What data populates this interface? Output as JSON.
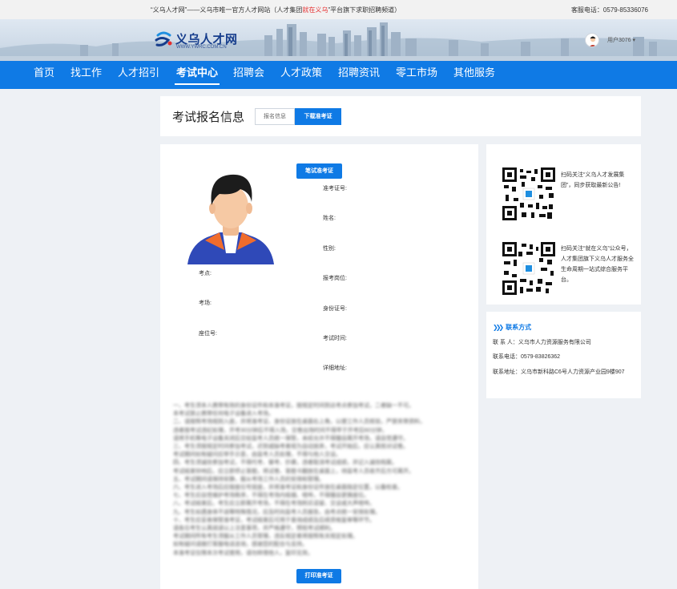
{
  "topbar": {
    "tagline_prefix": "“义乌人才网”——义乌市唯一官方人才网站（人才集团",
    "tagline_red": "就在义乌",
    "tagline_suffix": "\"平台旗下求职招聘频道）",
    "hotline": "客服电话：0579-85336076"
  },
  "header": {
    "logo_title": "义乌人才网",
    "logo_url": "WWW.YWRC.COM.CN",
    "user_name": "用户3076",
    "user_chevron": "▾"
  },
  "nav": {
    "items": [
      "首页",
      "找工作",
      "人才招引",
      "考试中心",
      "招聘会",
      "人才政策",
      "招聘资讯",
      "零工市场",
      "其他服务"
    ],
    "active_index": 3
  },
  "exam": {
    "title": "考试报名信息",
    "tab_info": "报名信息",
    "tab_download": "下载准考证",
    "btn_written": "笔试准考证",
    "btn_print": "打印准考证",
    "left_fields": [
      "考点:",
      "考场:",
      "座位号:"
    ],
    "right_fields": [
      "准考证号:",
      "姓名:",
      "性别:",
      "报考岗位:",
      "身份证号:",
      "考试时间:",
      "详细地址:"
    ],
    "notes": [
      "一、考生须本人携带有效的身份证件和本准考证，按规定时间到达考点参加考试，二者缺一不可。",
      "本考试禁止携带任何电子设备进入考场。",
      "二、请按照考场规则入座，并将准考证、身份证放在桌面右上角，以便工作人员核验，严禁夹带资料，",
      "违者按考试违纪处理，开考30分钟后不得入场，交卷出场时间不得早于开考后60分钟，",
      "请将手机等电子设备关闭后交给监考人员统一保管，未经允许不得擅自离开考场，请自觉遵守。",
      "三、考生须按规定时间参加考试，迟到或缺考者视为自动放弃，考试开始后，应认真核对试卷。",
      "考试期间如有疑问应举手示意，由监考人员处理，不得与他人交谈。",
      "四、考生须诚信参加考试，不得代考、替考、抄袭，违者取消考试成绩，并记入诚信档案。",
      "考试结束铃响后，应立即停止答题，将试卷、答题卡翻放在桌面上，待监考人员收齐后方可离开。",
      "五、考试期间请保持安静，服从考场工作人员的安排和管理。",
      "六、考生进入考场后应按座位号就座，并将准考证和身份证件放在桌面指定位置，以备检查。",
      "七、考生应自觉维护考场秩序，不得在考场内吸烟、喧哗，不得擅自更换座位。",
      "八、考试结束后，考生应立即离开考场，不得在考场附近逗留、交谈或大声喧哗。",
      "九、考生如遇身体不适等特殊情况，应及时向监考人员报告，由考点统一安排处理。",
      "十、考生应妥善保管准考证，考试结束后可用于查询成绩及后续资格复审等环节。",
      "请各位考生认真阅读以上注意事项，并严格遵守，预祝考试顺利。",
      "考试期间所有考生须服从工作人员管理，违反规定者将按照有关规定处理。",
      "如有疑问请拨打客服电话咨询，感谢您的配合与支持。",
      "本准考证仅限本次考试使用，请勿转借他人，复印无效。"
    ]
  },
  "qr": {
    "text1": "扫码关注“义乌人才发展集团”，同步获取最新公告!",
    "text2": "扫码关注“就在义乌”公众号，人才集团旗下义乌人才服务全生命周期一站式综合服务平台。"
  },
  "contact": {
    "title": "联系方式",
    "chevrons": "❯❯❯",
    "person": "联 系 人：义乌市人力资源服务有限公司",
    "phone": "联系电话：0579-83826362",
    "address": "联系地址：义乌市新科路C6号人力资源产业园9楼907"
  },
  "colors": {
    "brand": "#0f7ae5",
    "red": "#e62e2e",
    "bg": "#eef1f5"
  }
}
